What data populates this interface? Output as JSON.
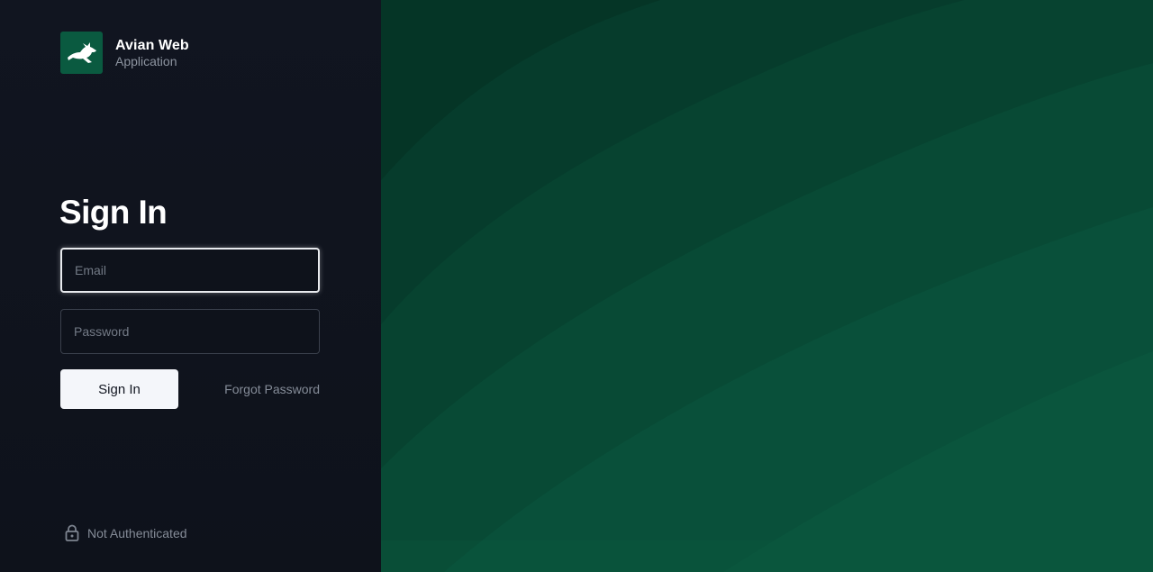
{
  "brand": {
    "title": "Avian Web",
    "subtitle": "Application",
    "logo_icon": "rabbit-icon"
  },
  "form": {
    "heading": "Sign In",
    "email_placeholder": "Email",
    "password_placeholder": "Password",
    "submit_label": "Sign In",
    "forgot_label": "Forgot Password"
  },
  "status": {
    "icon": "lock-icon",
    "label": "Not Authenticated"
  },
  "colors": {
    "left_background": "#0f1119",
    "brand_green": "#0a5a40",
    "hero_dark": "#05392a",
    "hero_light": "#0a5a40"
  }
}
